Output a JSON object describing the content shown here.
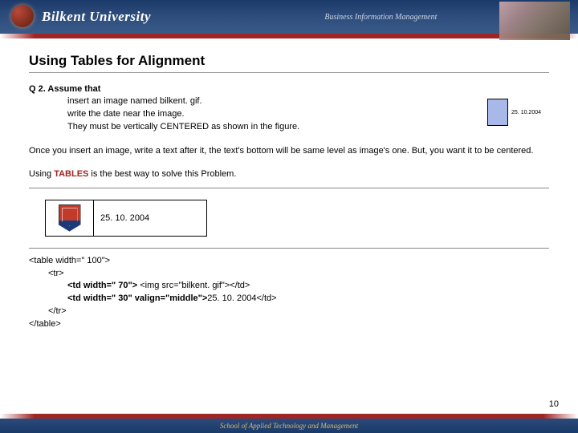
{
  "header": {
    "university": "Bilkent University",
    "department": "Business Information Management"
  },
  "slide": {
    "title": "Using Tables for Alignment",
    "question_label": "Q 2.  Assume that",
    "instructions": [
      "insert an image named bilkent. gif.",
      "write the date near the image.",
      "They must be vertically CENTERED as shown in the figure."
    ],
    "mini_date": "25. 10.2004",
    "paragraph": "Once you insert an image, write a text after it, the text's bottom will be same level as image's one. But, you want it to be centered.",
    "advice_pre": "Using ",
    "advice_key": "TABLES",
    "advice_post": " is the best way to solve this Problem.",
    "example_date": "25. 10. 2004",
    "code": {
      "l1": "<table width=\" 100\">",
      "l2": "<tr>",
      "l3_a": "<td width=\" 70\">",
      "l3_b": " <img src=\"bilkent. gif\"></td>",
      "l4_a": "<td width=\" 30\" valign=\"middle\">",
      "l4_b": "25. 10. 2004</td>",
      "l5": "</tr>",
      "l6": "</table>"
    },
    "page_number": "10"
  },
  "footer": {
    "school": "School of Applied Technology and Management"
  }
}
